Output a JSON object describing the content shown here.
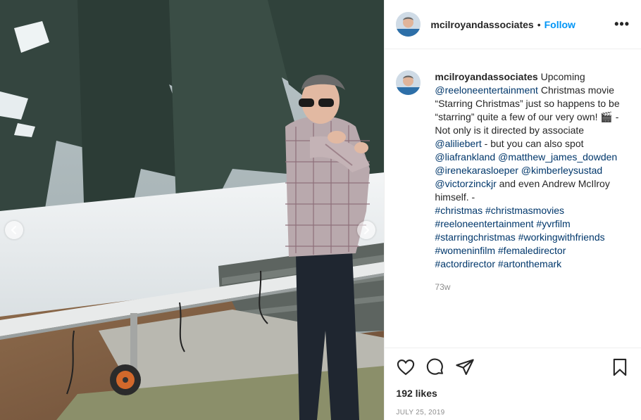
{
  "post": {
    "username": "mcilroyandassociates",
    "follow_label": "Follow",
    "separator": "•",
    "more_label": "•••"
  },
  "caption": {
    "username": "mcilroyandassociates",
    "parts": [
      {
        "t": " Upcoming "
      },
      {
        "t": "@reeloneentertainment",
        "link": true
      },
      {
        "t": " Christmas movie “Starring Christmas” just so happens to be “starring” quite a few of our very own! 🎬 -\nNot only is it directed by associate "
      },
      {
        "t": "@aliliebert",
        "link": true
      },
      {
        "t": " - but you can also spot "
      },
      {
        "t": "@liafrankland",
        "link": true
      },
      {
        "t": " "
      },
      {
        "t": "@matthew_james_dowden",
        "link": true
      },
      {
        "t": " "
      },
      {
        "t": "@irenekarasloeper",
        "link": true
      },
      {
        "t": " "
      },
      {
        "t": "@kimberleysustad",
        "link": true
      },
      {
        "t": " "
      },
      {
        "t": "@victorzinckjr",
        "link": true
      },
      {
        "t": " and even Andrew McIlroy himself. -\n"
      },
      {
        "t": "#christmas",
        "link": true
      },
      {
        "t": " "
      },
      {
        "t": "#christmasmovies",
        "link": true
      },
      {
        "t": " "
      },
      {
        "t": "#reeloneentertainment",
        "link": true
      },
      {
        "t": " "
      },
      {
        "t": "#yvrfilm",
        "link": true
      },
      {
        "t": " "
      },
      {
        "t": "#starringchristmas",
        "link": true
      },
      {
        "t": " "
      },
      {
        "t": "#workingwithfriends",
        "link": true
      },
      {
        "t": " "
      },
      {
        "t": "#womeninfilm",
        "link": true
      },
      {
        "t": " "
      },
      {
        "t": "#femaledirector",
        "link": true
      },
      {
        "t": " "
      },
      {
        "t": "#actordirector",
        "link": true
      },
      {
        "t": " "
      },
      {
        "t": "#artonthemark",
        "link": true
      }
    ],
    "age": "73w"
  },
  "actions": {
    "like_icon": "heart-icon",
    "comment_icon": "comment-icon",
    "share_icon": "paper-plane-icon",
    "save_icon": "bookmark-icon",
    "likes": "192 likes",
    "date": "JULY 25, 2019"
  },
  "colors": {
    "accent": "#0095f6",
    "link": "#00376b",
    "muted": "#8e8e8e",
    "text": "#262626"
  }
}
